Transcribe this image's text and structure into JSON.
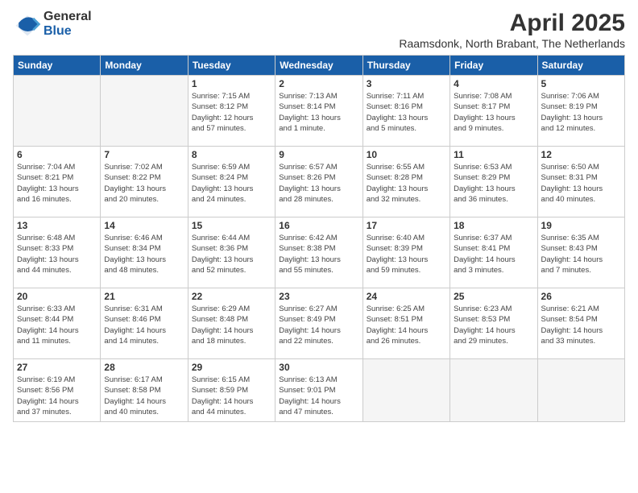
{
  "logo": {
    "general": "General",
    "blue": "Blue"
  },
  "title": "April 2025",
  "subtitle": "Raamsdonk, North Brabant, The Netherlands",
  "headers": [
    "Sunday",
    "Monday",
    "Tuesday",
    "Wednesday",
    "Thursday",
    "Friday",
    "Saturday"
  ],
  "weeks": [
    [
      {
        "day": "",
        "text": "",
        "empty": true
      },
      {
        "day": "",
        "text": "",
        "empty": true
      },
      {
        "day": "1",
        "text": "Sunrise: 7:15 AM\nSunset: 8:12 PM\nDaylight: 12 hours\nand 57 minutes."
      },
      {
        "day": "2",
        "text": "Sunrise: 7:13 AM\nSunset: 8:14 PM\nDaylight: 13 hours\nand 1 minute."
      },
      {
        "day": "3",
        "text": "Sunrise: 7:11 AM\nSunset: 8:16 PM\nDaylight: 13 hours\nand 5 minutes."
      },
      {
        "day": "4",
        "text": "Sunrise: 7:08 AM\nSunset: 8:17 PM\nDaylight: 13 hours\nand 9 minutes."
      },
      {
        "day": "5",
        "text": "Sunrise: 7:06 AM\nSunset: 8:19 PM\nDaylight: 13 hours\nand 12 minutes."
      }
    ],
    [
      {
        "day": "6",
        "text": "Sunrise: 7:04 AM\nSunset: 8:21 PM\nDaylight: 13 hours\nand 16 minutes."
      },
      {
        "day": "7",
        "text": "Sunrise: 7:02 AM\nSunset: 8:22 PM\nDaylight: 13 hours\nand 20 minutes."
      },
      {
        "day": "8",
        "text": "Sunrise: 6:59 AM\nSunset: 8:24 PM\nDaylight: 13 hours\nand 24 minutes."
      },
      {
        "day": "9",
        "text": "Sunrise: 6:57 AM\nSunset: 8:26 PM\nDaylight: 13 hours\nand 28 minutes."
      },
      {
        "day": "10",
        "text": "Sunrise: 6:55 AM\nSunset: 8:28 PM\nDaylight: 13 hours\nand 32 minutes."
      },
      {
        "day": "11",
        "text": "Sunrise: 6:53 AM\nSunset: 8:29 PM\nDaylight: 13 hours\nand 36 minutes."
      },
      {
        "day": "12",
        "text": "Sunrise: 6:50 AM\nSunset: 8:31 PM\nDaylight: 13 hours\nand 40 minutes."
      }
    ],
    [
      {
        "day": "13",
        "text": "Sunrise: 6:48 AM\nSunset: 8:33 PM\nDaylight: 13 hours\nand 44 minutes."
      },
      {
        "day": "14",
        "text": "Sunrise: 6:46 AM\nSunset: 8:34 PM\nDaylight: 13 hours\nand 48 minutes."
      },
      {
        "day": "15",
        "text": "Sunrise: 6:44 AM\nSunset: 8:36 PM\nDaylight: 13 hours\nand 52 minutes."
      },
      {
        "day": "16",
        "text": "Sunrise: 6:42 AM\nSunset: 8:38 PM\nDaylight: 13 hours\nand 55 minutes."
      },
      {
        "day": "17",
        "text": "Sunrise: 6:40 AM\nSunset: 8:39 PM\nDaylight: 13 hours\nand 59 minutes."
      },
      {
        "day": "18",
        "text": "Sunrise: 6:37 AM\nSunset: 8:41 PM\nDaylight: 14 hours\nand 3 minutes."
      },
      {
        "day": "19",
        "text": "Sunrise: 6:35 AM\nSunset: 8:43 PM\nDaylight: 14 hours\nand 7 minutes."
      }
    ],
    [
      {
        "day": "20",
        "text": "Sunrise: 6:33 AM\nSunset: 8:44 PM\nDaylight: 14 hours\nand 11 minutes."
      },
      {
        "day": "21",
        "text": "Sunrise: 6:31 AM\nSunset: 8:46 PM\nDaylight: 14 hours\nand 14 minutes."
      },
      {
        "day": "22",
        "text": "Sunrise: 6:29 AM\nSunset: 8:48 PM\nDaylight: 14 hours\nand 18 minutes."
      },
      {
        "day": "23",
        "text": "Sunrise: 6:27 AM\nSunset: 8:49 PM\nDaylight: 14 hours\nand 22 minutes."
      },
      {
        "day": "24",
        "text": "Sunrise: 6:25 AM\nSunset: 8:51 PM\nDaylight: 14 hours\nand 26 minutes."
      },
      {
        "day": "25",
        "text": "Sunrise: 6:23 AM\nSunset: 8:53 PM\nDaylight: 14 hours\nand 29 minutes."
      },
      {
        "day": "26",
        "text": "Sunrise: 6:21 AM\nSunset: 8:54 PM\nDaylight: 14 hours\nand 33 minutes."
      }
    ],
    [
      {
        "day": "27",
        "text": "Sunrise: 6:19 AM\nSunset: 8:56 PM\nDaylight: 14 hours\nand 37 minutes."
      },
      {
        "day": "28",
        "text": "Sunrise: 6:17 AM\nSunset: 8:58 PM\nDaylight: 14 hours\nand 40 minutes."
      },
      {
        "day": "29",
        "text": "Sunrise: 6:15 AM\nSunset: 8:59 PM\nDaylight: 14 hours\nand 44 minutes."
      },
      {
        "day": "30",
        "text": "Sunrise: 6:13 AM\nSunset: 9:01 PM\nDaylight: 14 hours\nand 47 minutes."
      },
      {
        "day": "",
        "text": "",
        "empty": true
      },
      {
        "day": "",
        "text": "",
        "empty": true
      },
      {
        "day": "",
        "text": "",
        "empty": true
      }
    ]
  ]
}
